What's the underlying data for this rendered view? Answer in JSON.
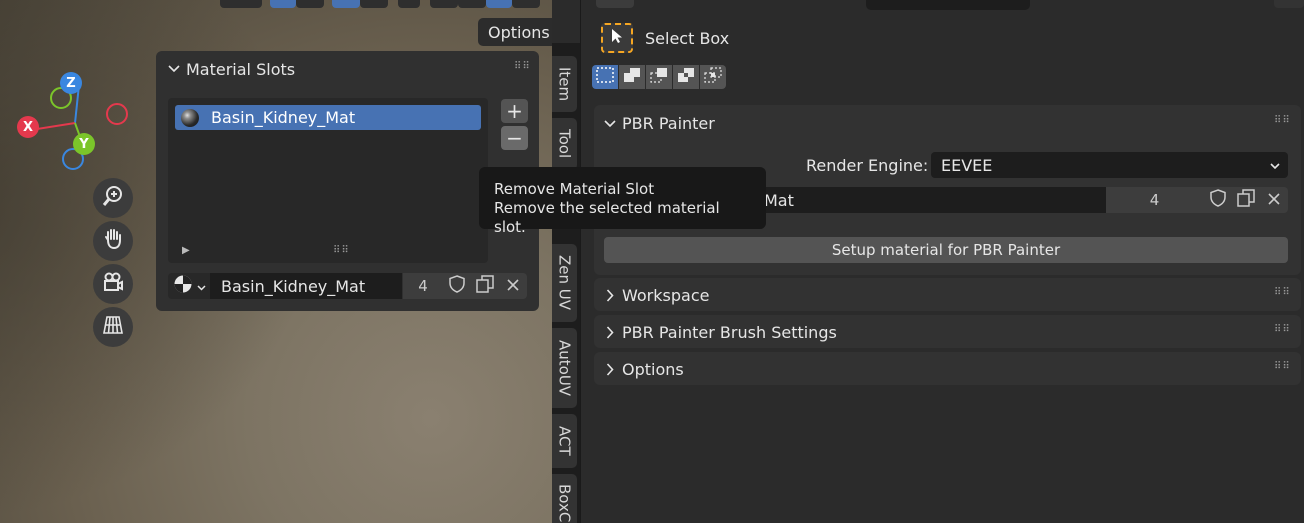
{
  "viewport": {
    "options_label": "Options",
    "gizmo": {
      "z": "Z",
      "x": "X",
      "y": "Y"
    }
  },
  "material_slots": {
    "title": "Material Slots",
    "slots": [
      {
        "name": "Basin_Kidney_Mat",
        "selected": true
      }
    ],
    "add_symbol": "+",
    "remove_symbol": "−",
    "datablock": {
      "name": "Basin_Kidney_Mat",
      "users": "4"
    }
  },
  "sidebar_tabs": [
    "Item",
    "Tool",
    "Zen UV",
    "AutoUV",
    "ACT",
    "BoxC"
  ],
  "tooltip": {
    "title": "Remove Material Slot",
    "description": "Remove the selected material slot."
  },
  "tool_settings": {
    "tool_name": "Select Box"
  },
  "pbr_painter": {
    "title": "PBR Painter",
    "render_engine_label": "Render Engine:",
    "render_engine_value": "EEVEE",
    "material_name_visible": "Mat",
    "material_users": "4",
    "setup_button": "Setup material for PBR Painter"
  },
  "collapsed_panels": [
    "Workspace",
    "PBR Painter Brush Settings",
    "Options"
  ],
  "colors": {
    "accent": "#4772b3",
    "x_axis": "#e4394d",
    "y_axis": "#7bc52a",
    "z_axis": "#3a87e0",
    "tool_highlight": "#f5a623"
  }
}
